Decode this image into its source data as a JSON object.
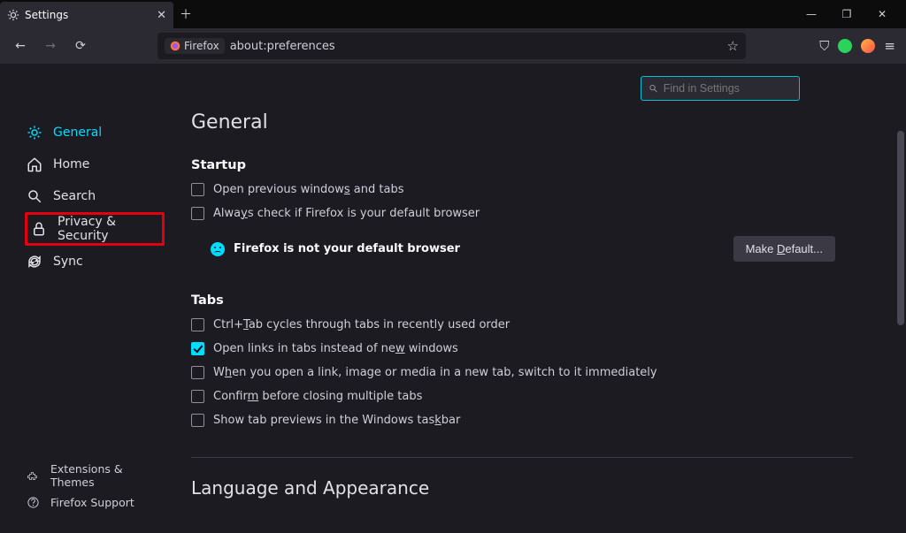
{
  "window": {
    "tab_title": "Settings",
    "url_text": "about:preferences",
    "firefox_label": "Firefox",
    "search_placeholder": "Find in Settings"
  },
  "sidebar": {
    "items": [
      {
        "label": "General",
        "active": true
      },
      {
        "label": "Home"
      },
      {
        "label": "Search"
      },
      {
        "label": "Privacy & Security",
        "highlighted": true
      },
      {
        "label": "Sync"
      }
    ],
    "bottom": [
      {
        "label": "Extensions & Themes"
      },
      {
        "label": "Firefox Support"
      }
    ]
  },
  "page": {
    "title": "General",
    "startup_heading": "Startup",
    "startup_options": [
      {
        "label_pre": "Open previous window",
        "und": "s",
        "label_post": " and tabs",
        "checked": false
      },
      {
        "label_pre": "Alwa",
        "und": "y",
        "label_post": "s check if Firefox is your default browser",
        "checked": false
      }
    ],
    "status_text": "Firefox is not your default browser",
    "make_default_pre": "Make ",
    "make_default_und": "D",
    "make_default_post": "efault...",
    "tabs_heading": "Tabs",
    "tabs_options": [
      {
        "label_pre": "Ctrl+",
        "und": "T",
        "label_post": "ab cycles through tabs in recently used order",
        "checked": false
      },
      {
        "label_pre": "Open links in tabs instead of ne",
        "und": "w",
        "label_post": " windows",
        "checked": true
      },
      {
        "label_pre": "W",
        "und": "h",
        "label_post": "en you open a link, image or media in a new tab, switch to it immediately",
        "checked": false
      },
      {
        "label_pre": "Confir",
        "und": "m",
        "label_post": " before closing multiple tabs",
        "checked": false
      },
      {
        "label_pre": "Show tab previews in the Windows tas",
        "und": "k",
        "label_post": "bar",
        "checked": false
      }
    ],
    "lang_heading": "Language and Appearance"
  },
  "colors": {
    "green": "#2bd35a",
    "orange": "#ffb53d"
  }
}
